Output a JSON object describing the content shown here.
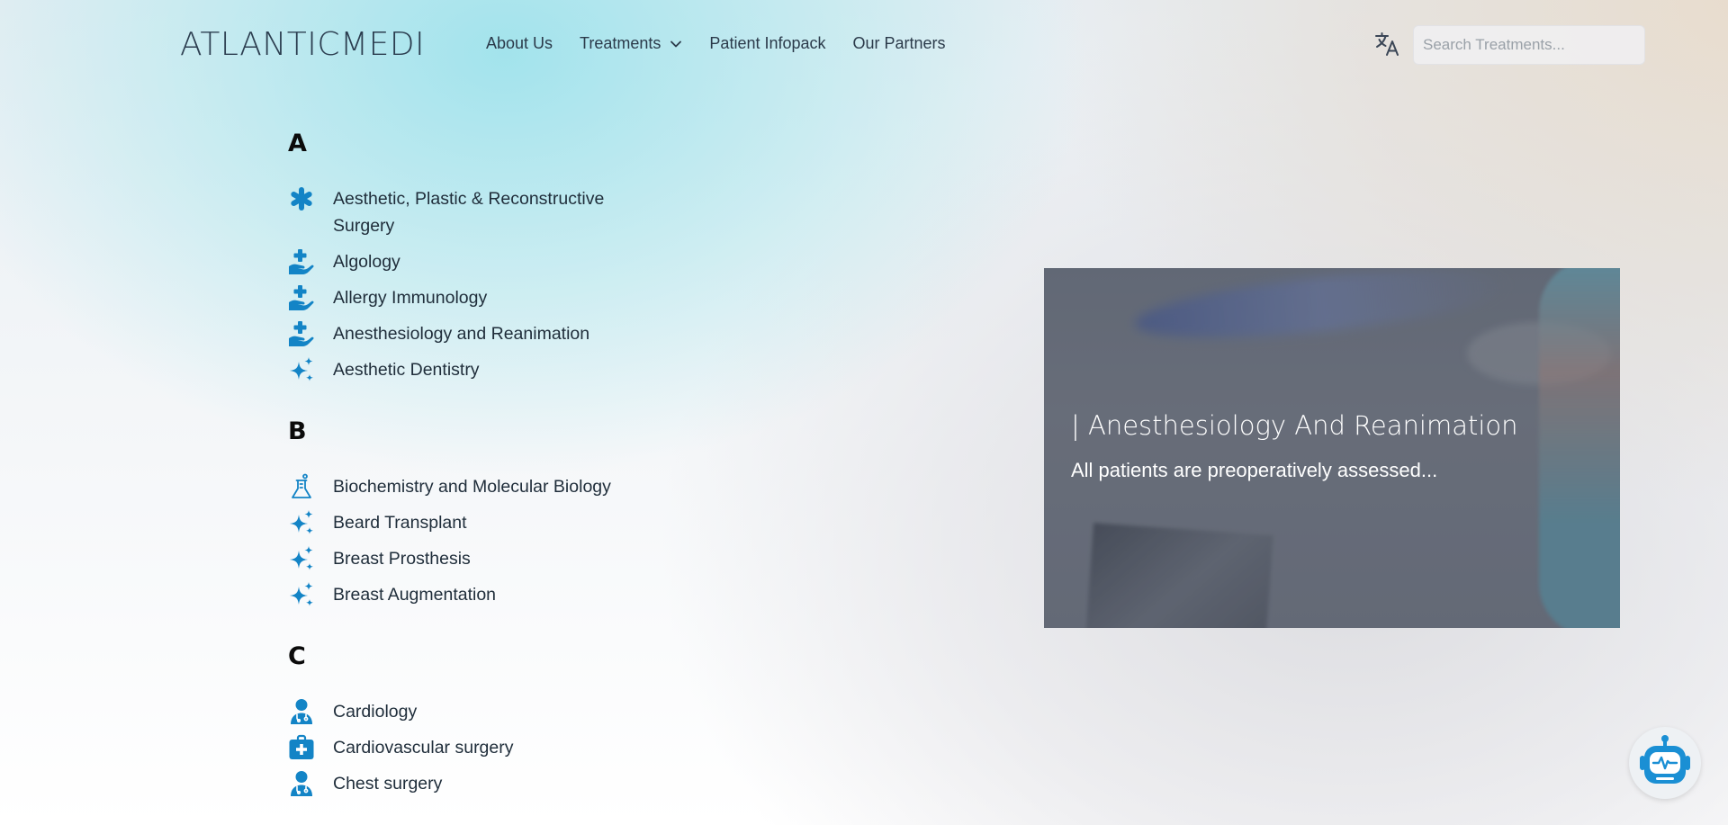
{
  "header": {
    "logo": "ATLANTICMEDI",
    "nav": [
      {
        "label": "About Us"
      },
      {
        "label": "Treatments",
        "has_dropdown": true
      },
      {
        "label": "Patient Infopack"
      },
      {
        "label": "Our Partners"
      }
    ],
    "translate_icon": "translate-icon",
    "search": {
      "placeholder": "Search Treatments...",
      "value": ""
    }
  },
  "treatments": [
    {
      "letter": "A",
      "items": [
        {
          "label": "Aesthetic, Plastic & Reconstructive Surgery",
          "icon": "asterisk-icon"
        },
        {
          "label": "Algology",
          "icon": "hand-medical-icon"
        },
        {
          "label": "Allergy Immunology",
          "icon": "hand-medical-icon"
        },
        {
          "label": "Anesthesiology and Reanimation",
          "icon": "hand-medical-icon"
        },
        {
          "label": "Aesthetic Dentistry",
          "icon": "sparkles-icon"
        }
      ]
    },
    {
      "letter": "B",
      "items": [
        {
          "label": "Biochemistry and Molecular Biology",
          "icon": "flask-icon"
        },
        {
          "label": "Beard Transplant",
          "icon": "sparkles-icon"
        },
        {
          "label": "Breast Prosthesis",
          "icon": "sparkles-icon"
        },
        {
          "label": "Breast Augmentation",
          "icon": "sparkles-icon"
        }
      ]
    },
    {
      "letter": "C",
      "items": [
        {
          "label": "Cardiology",
          "icon": "doctor-icon"
        },
        {
          "label": "Cardiovascular surgery",
          "icon": "medical-kit-icon"
        },
        {
          "label": "Chest surgery",
          "icon": "doctor-icon"
        }
      ]
    }
  ],
  "hero": {
    "title": "| Anesthesiology And Reanimation",
    "subtitle": "All patients are preoperatively assessed..."
  },
  "chatbot": {
    "icon": "robot-icon"
  },
  "colors": {
    "icon_blue": "#1384c6",
    "text_dark": "#1f2d3a"
  }
}
